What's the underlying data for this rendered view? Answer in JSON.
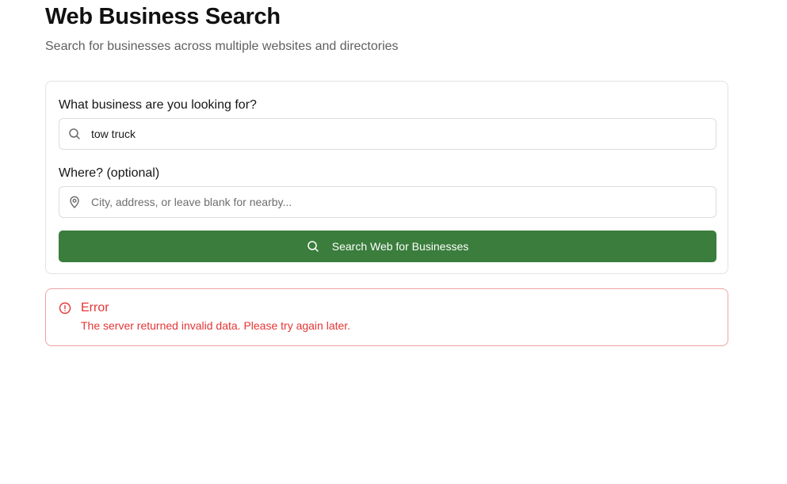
{
  "header": {
    "title": "Web Business Search",
    "subtitle": "Search for businesses across multiple websites and directories"
  },
  "form": {
    "business_label": "What business are you looking for?",
    "business_value": "tow truck",
    "business_icon": "search-icon",
    "location_label": "Where? (optional)",
    "location_value": "",
    "location_placeholder": "City, address, or leave blank for nearby...",
    "location_icon": "map-pin-icon",
    "submit_label": "Search Web for Businesses",
    "submit_icon": "search-icon"
  },
  "error": {
    "icon": "alert-circle-icon",
    "title": "Error",
    "message": "The server returned invalid data. Please try again later."
  },
  "colors": {
    "primary_button": "#3a7d3c",
    "error": "#e53535",
    "error_border": "#f0a3a3",
    "card_border": "#e3e3e3"
  }
}
